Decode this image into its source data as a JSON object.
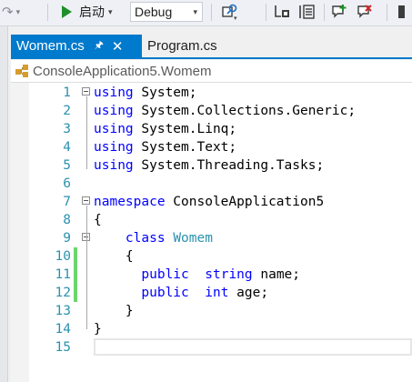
{
  "toolbar": {
    "start_label": "启动",
    "config_value": "Debug"
  },
  "tabs": [
    {
      "title": "Womem.cs",
      "active": true
    },
    {
      "title": "Program.cs",
      "active": false
    }
  ],
  "navbar": {
    "class_label": "ConsoleApplication5.Womem"
  },
  "code_lines": [
    {
      "num": "1",
      "segments": [
        [
          "kw",
          "using"
        ],
        [
          "t",
          " System;"
        ]
      ]
    },
    {
      "num": "2",
      "segments": [
        [
          "kw",
          "using"
        ],
        [
          "t",
          " System.Collections.Generic;"
        ]
      ]
    },
    {
      "num": "3",
      "segments": [
        [
          "kw",
          "using"
        ],
        [
          "t",
          " System.Linq;"
        ]
      ]
    },
    {
      "num": "4",
      "segments": [
        [
          "kw",
          "using"
        ],
        [
          "t",
          " System.Text;"
        ]
      ]
    },
    {
      "num": "5",
      "segments": [
        [
          "kw",
          "using"
        ],
        [
          "t",
          " System.Threading.Tasks;"
        ]
      ]
    },
    {
      "num": "6",
      "segments": []
    },
    {
      "num": "7",
      "segments": [
        [
          "kw",
          "namespace"
        ],
        [
          "t",
          " ConsoleApplication5"
        ]
      ]
    },
    {
      "num": "8",
      "segments": [
        [
          "t",
          "{"
        ]
      ]
    },
    {
      "num": "9",
      "segments": [
        [
          "t",
          "    "
        ],
        [
          "kw",
          "class"
        ],
        [
          "t",
          " "
        ],
        [
          "ty",
          "Womem"
        ]
      ]
    },
    {
      "num": "10",
      "segments": [
        [
          "t",
          "    {"
        ]
      ]
    },
    {
      "num": "11",
      "segments": [
        [
          "t",
          "      "
        ],
        [
          "kw",
          "public"
        ],
        [
          "t",
          "  "
        ],
        [
          "kw",
          "string"
        ],
        [
          "t",
          " name;"
        ]
      ]
    },
    {
      "num": "12",
      "segments": [
        [
          "t",
          "      "
        ],
        [
          "kw",
          "public"
        ],
        [
          "t",
          "  "
        ],
        [
          "kw",
          "int"
        ],
        [
          "t",
          " age;"
        ]
      ]
    },
    {
      "num": "13",
      "segments": [
        [
          "t",
          "    }"
        ]
      ]
    },
    {
      "num": "14",
      "segments": [
        [
          "t",
          "}"
        ]
      ]
    },
    {
      "num": "15",
      "segments": []
    }
  ],
  "colors": {
    "keyword": "#0000ff",
    "type": "#2b91af",
    "line_number": "#2b91af",
    "tab_active": "#007acc",
    "changed_marker": "#6cd66c"
  }
}
